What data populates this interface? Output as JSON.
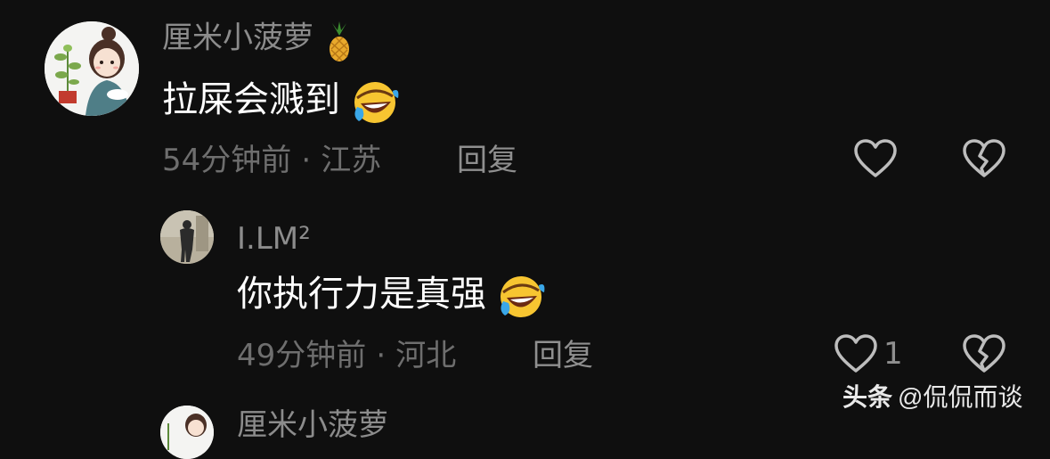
{
  "comments": [
    {
      "username": "厘米小菠萝",
      "username_emoji": "pineapple",
      "text": "拉屎会溅到",
      "text_emoji": "rolling-laughing-face",
      "time": "54分钟前",
      "separator": "·",
      "location": "江苏",
      "reply_label": "回复"
    },
    {
      "username": "I.LM²",
      "text": "你执行力是真强",
      "text_emoji": "rolling-laughing-face",
      "time": "49分钟前",
      "separator": "·",
      "location": "河北",
      "reply_label": "回复",
      "like_count": "1"
    },
    {
      "username": "厘米小菠萝"
    }
  ],
  "watermark": {
    "brand": "头条",
    "handle": "@侃侃而谈"
  },
  "colors": {
    "background": "#0f0f0f",
    "username": "#8c8c8c",
    "content": "#ffffff",
    "meta": "#6e6e6e",
    "icon": "#bdbdbd"
  },
  "icons": [
    "pineapple-icon",
    "heart-outline-icon",
    "broken-heart-icon",
    "laughing-emoji-icon"
  ]
}
